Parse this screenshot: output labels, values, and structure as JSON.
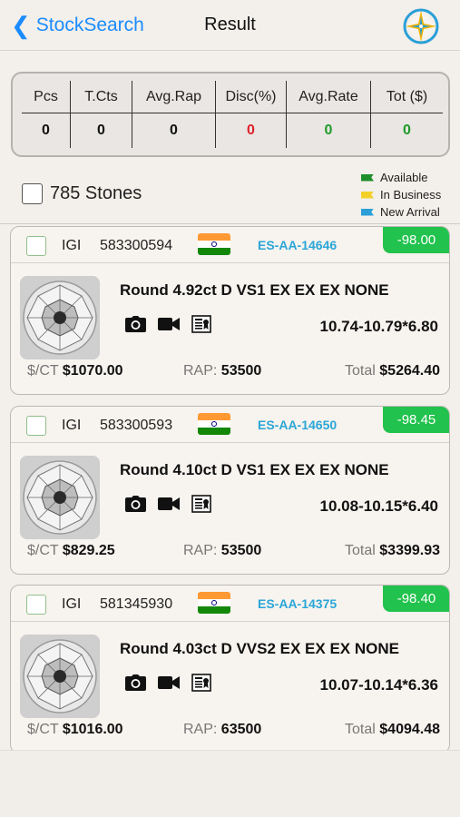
{
  "nav": {
    "back_label": "StockSearch",
    "title": "Result"
  },
  "summary": {
    "headers": [
      "Pcs",
      "T.Cts",
      "Avg.Rap",
      "Disc(%)",
      "Avg.Rate",
      "Tot ($)"
    ],
    "values": [
      "0",
      "0",
      "0",
      "0",
      "0",
      "0"
    ]
  },
  "filter": {
    "count_label": "785 Stones"
  },
  "legend": [
    {
      "label": "Available",
      "color": "#1e8e2b"
    },
    {
      "label": "In Business",
      "color": "#f2d02a"
    },
    {
      "label": "New Arrival",
      "color": "#2a9fd8"
    }
  ],
  "labels": {
    "per_ct": "$/CT",
    "rap": "RAP:",
    "total": "Total"
  },
  "stones": [
    {
      "lab": "IGI",
      "cert": "583300594",
      "code": "ES-AA-14646",
      "discount": "-98.00",
      "description": "Round 4.92ct D VS1 EX EX EX NONE",
      "measurement": "10.74-10.79*6.80",
      "per_ct": "$1070.00",
      "rap": "53500",
      "total": "$5264.40"
    },
    {
      "lab": "IGI",
      "cert": "583300593",
      "code": "ES-AA-14650",
      "discount": "-98.45",
      "description": "Round 4.10ct D VS1 EX EX EX NONE",
      "measurement": "10.08-10.15*6.40",
      "per_ct": "$829.25",
      "rap": "53500",
      "total": "$3399.93"
    },
    {
      "lab": "IGI",
      "cert": "581345930",
      "code": "ES-AA-14375",
      "discount": "-98.40",
      "description": "Round 4.03ct D VVS2 EX EX EX NONE",
      "measurement": "10.07-10.14*6.36",
      "per_ct": "$1016.00",
      "rap": "63500",
      "total": "$4094.48"
    }
  ]
}
